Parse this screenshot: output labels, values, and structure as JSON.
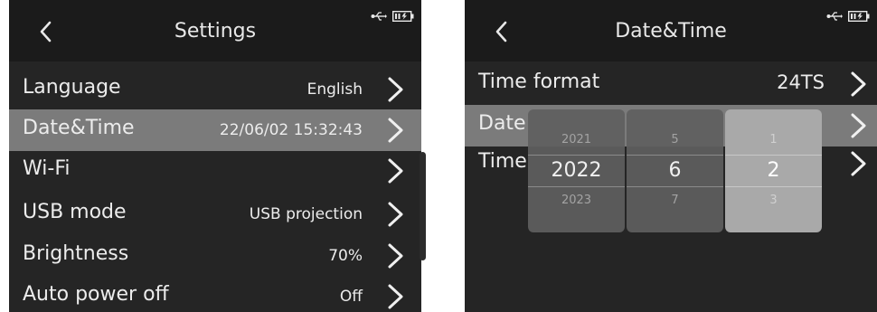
{
  "settings_screen": {
    "title": "Settings",
    "items": [
      {
        "label": "Language",
        "value": "English"
      },
      {
        "label": "Date&Time",
        "value": "22/06/02 15:32:43",
        "selected": true
      },
      {
        "label": "Wi-Fi",
        "value": ""
      },
      {
        "label": "USB mode",
        "value": "USB projection"
      },
      {
        "label": "Brightness",
        "value": "70%"
      },
      {
        "label": "Auto power off",
        "value": "Off"
      }
    ]
  },
  "datetime_screen": {
    "title": "Date&Time",
    "items": [
      {
        "label": "Time format",
        "value": "24TS"
      },
      {
        "label": "Date",
        "value": "",
        "selected": true
      },
      {
        "label": "Time",
        "value": ""
      }
    ],
    "picker": {
      "columns": [
        {
          "prev": "2021",
          "current": "2022",
          "next": "2023",
          "active": false
        },
        {
          "prev": "5",
          "current": "6",
          "next": "7",
          "active": false
        },
        {
          "prev": "1",
          "current": "2",
          "next": "3",
          "active": true
        }
      ]
    }
  },
  "icons": {
    "back": "chevron-left-icon",
    "item_arrow": "chevron-right-icon",
    "usb": "usb-icon",
    "battery": "battery-icon"
  },
  "colors": {
    "screen_bg": "#252525",
    "header_bg": "#1b1b1b",
    "selected_row": "#7b7b7b",
    "text": "#ececec"
  }
}
